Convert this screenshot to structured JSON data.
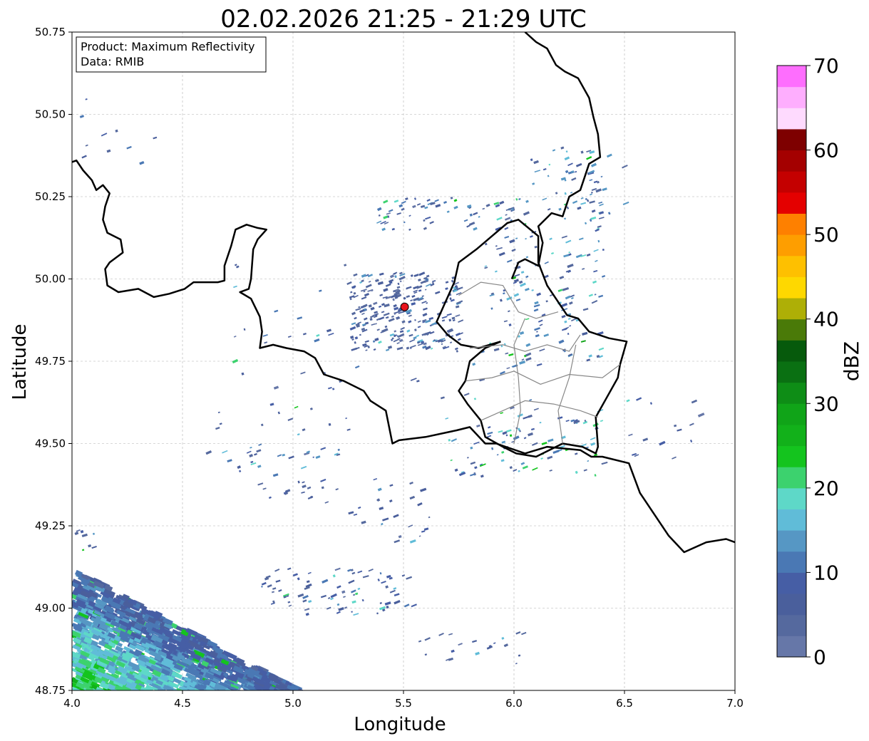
{
  "title": "02.02.2026 21:25 - 21:29 UTC",
  "info_box": {
    "product_line": "Product: Maximum Reflectivity",
    "data_line": "Data: RMIB"
  },
  "map": {
    "x_axis": {
      "label": "Longitude",
      "range": [
        4.0,
        7.0
      ],
      "ticks": [
        4.0,
        4.5,
        5.0,
        5.5,
        6.0,
        6.5,
        7.0
      ],
      "tick_labels": [
        "4.0",
        "4.5",
        "5.0",
        "5.5",
        "6.0",
        "6.5",
        "7.0"
      ]
    },
    "y_axis": {
      "label": "Latitude",
      "range": [
        48.75,
        50.75
      ],
      "ticks": [
        48.75,
        49.0,
        49.25,
        49.5,
        49.75,
        50.0,
        50.25,
        50.5,
        50.75
      ],
      "tick_labels": [
        "48.75",
        "49.00",
        "49.25",
        "49.50",
        "49.75",
        "50.00",
        "50.25",
        "50.50",
        "50.75"
      ]
    },
    "grid": true,
    "radar_site": {
      "lon": 5.505,
      "lat": 49.915,
      "color": "#e8141c"
    },
    "borders": {
      "color": "#000000",
      "line_a": [
        [
          4.0,
          50.355
        ],
        [
          4.02,
          50.36
        ],
        [
          4.05,
          50.33
        ],
        [
          4.09,
          50.3
        ],
        [
          4.11,
          50.27
        ],
        [
          4.14,
          50.285
        ],
        [
          4.17,
          50.26
        ],
        [
          4.15,
          50.22
        ],
        [
          4.14,
          50.18
        ],
        [
          4.16,
          50.14
        ],
        [
          4.22,
          50.12
        ],
        [
          4.23,
          50.08
        ],
        [
          4.17,
          50.05
        ],
        [
          4.15,
          50.03
        ],
        [
          4.16,
          49.98
        ],
        [
          4.21,
          49.96
        ],
        [
          4.3,
          49.97
        ],
        [
          4.37,
          49.945
        ],
        [
          4.44,
          49.955
        ],
        [
          4.51,
          49.97
        ],
        [
          4.55,
          49.99
        ],
        [
          4.66,
          49.99
        ],
        [
          4.69,
          49.995
        ],
        [
          4.69,
          50.04
        ],
        [
          4.72,
          50.1
        ],
        [
          4.74,
          50.15
        ],
        [
          4.79,
          50.165
        ],
        [
          4.84,
          50.155
        ],
        [
          4.88,
          50.15
        ],
        [
          4.84,
          50.12
        ],
        [
          4.82,
          50.09
        ],
        [
          4.81,
          50.0
        ],
        [
          4.8,
          49.97
        ],
        [
          4.76,
          49.96
        ],
        [
          4.81,
          49.94
        ],
        [
          4.85,
          49.885
        ],
        [
          4.86,
          49.84
        ],
        [
          4.85,
          49.79
        ],
        [
          4.91,
          49.8
        ],
        [
          4.97,
          49.79
        ],
        [
          5.05,
          49.78
        ],
        [
          5.1,
          49.76
        ],
        [
          5.14,
          49.71
        ],
        [
          5.23,
          49.69
        ],
        [
          5.32,
          49.66
        ],
        [
          5.35,
          49.63
        ],
        [
          5.42,
          49.6
        ],
        [
          5.45,
          49.5
        ],
        [
          5.48,
          49.51
        ],
        [
          5.6,
          49.52
        ],
        [
          5.74,
          49.54
        ],
        [
          5.8,
          49.55
        ],
        [
          5.87,
          49.5
        ],
        [
          5.92,
          49.5
        ],
        [
          6.05,
          49.47
        ],
        [
          6.15,
          49.49
        ],
        [
          6.3,
          49.48
        ],
        [
          6.35,
          49.46
        ],
        [
          6.4,
          49.46
        ],
        [
          6.52,
          49.44
        ],
        [
          6.57,
          49.35
        ],
        [
          6.7,
          49.22
        ],
        [
          6.77,
          49.17
        ],
        [
          6.87,
          49.2
        ],
        [
          6.96,
          49.21
        ],
        [
          7.0,
          49.2
        ]
      ],
      "line_b": [
        [
          5.99,
          50.0
        ],
        [
          6.02,
          50.05
        ],
        [
          6.05,
          50.06
        ],
        [
          6.11,
          50.04
        ],
        [
          6.13,
          50.11
        ],
        [
          6.11,
          50.16
        ],
        [
          6.17,
          50.2
        ],
        [
          6.22,
          50.19
        ],
        [
          6.25,
          50.25
        ],
        [
          6.3,
          50.27
        ],
        [
          6.34,
          50.35
        ],
        [
          6.39,
          50.37
        ],
        [
          6.38,
          50.44
        ],
        [
          6.36,
          50.49
        ],
        [
          6.34,
          50.55
        ],
        [
          6.29,
          50.61
        ],
        [
          6.23,
          50.63
        ],
        [
          6.19,
          50.65
        ],
        [
          6.15,
          50.7
        ],
        [
          6.1,
          50.72
        ],
        [
          6.05,
          50.75
        ]
      ],
      "luxembourg": [
        [
          5.94,
          49.81
        ],
        [
          5.87,
          49.79
        ],
        [
          5.8,
          49.75
        ],
        [
          5.78,
          49.69
        ],
        [
          5.75,
          49.66
        ],
        [
          5.79,
          49.62
        ],
        [
          5.85,
          49.57
        ],
        [
          5.87,
          49.52
        ],
        [
          5.95,
          49.49
        ],
        [
          6.01,
          49.47
        ],
        [
          6.1,
          49.46
        ],
        [
          6.22,
          49.5
        ],
        [
          6.31,
          49.49
        ],
        [
          6.37,
          49.47
        ],
        [
          6.38,
          49.49
        ],
        [
          6.37,
          49.58
        ],
        [
          6.42,
          49.64
        ],
        [
          6.47,
          49.7
        ],
        [
          6.48,
          49.74
        ],
        [
          6.51,
          49.81
        ],
        [
          6.43,
          49.82
        ],
        [
          6.34,
          49.84
        ],
        [
          6.29,
          49.88
        ],
        [
          6.24,
          49.89
        ],
        [
          6.2,
          49.93
        ],
        [
          6.15,
          49.98
        ],
        [
          6.11,
          50.05
        ],
        [
          6.11,
          50.13
        ],
        [
          6.02,
          50.18
        ],
        [
          5.97,
          50.17
        ],
        [
          5.9,
          50.13
        ],
        [
          5.83,
          50.09
        ],
        [
          5.75,
          50.05
        ],
        [
          5.73,
          49.99
        ],
        [
          5.69,
          49.93
        ],
        [
          5.65,
          49.87
        ],
        [
          5.7,
          49.83
        ],
        [
          5.76,
          49.8
        ],
        [
          5.84,
          49.79
        ],
        [
          5.94,
          49.81
        ]
      ]
    }
  },
  "colorbar": {
    "label": "dBZ",
    "min": 0,
    "max": 70,
    "step": 2.5,
    "ticks": [
      0,
      10,
      20,
      30,
      40,
      50,
      60,
      70
    ],
    "tick_labels": [
      "0",
      "10",
      "20",
      "30",
      "40",
      "50",
      "60",
      "70"
    ],
    "colors": [
      "#6677a8",
      "#55699e",
      "#4a5f9c",
      "#465ea5",
      "#4a78b4",
      "#5697c4",
      "#60bcd8",
      "#5ed8c8",
      "#3cd26e",
      "#14c41e",
      "#12b11a",
      "#10a418",
      "#0e8d16",
      "#0a7012",
      "#065a0c",
      "#4a7a08",
      "#aeaf06",
      "#fed800",
      "#fec000",
      "#fe9e00",
      "#fe8000",
      "#e40000",
      "#c40000",
      "#a40000",
      "#7e0000",
      "#fedafe",
      "#feaefe",
      "#fe6efe",
      "#f23cf2"
    ]
  }
}
